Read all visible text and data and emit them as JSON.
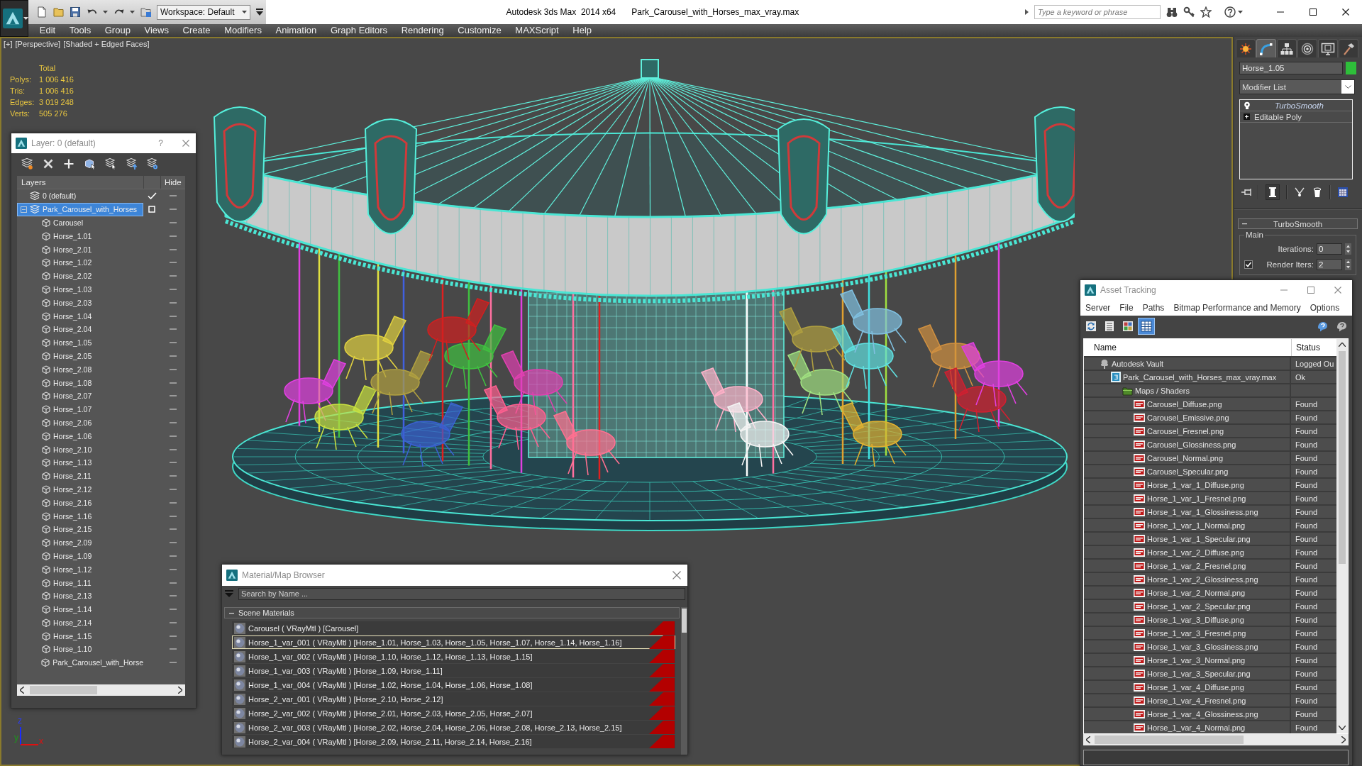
{
  "title_bar": {
    "workspace": "Workspace: Default",
    "app_title": "Autodesk 3ds Max  2014 x64",
    "file_name": "Park_Carousel_with_Horses_max_vray.max",
    "search": {
      "placeholder": "Type a keyword or phrase"
    }
  },
  "menu_bar": {
    "items": [
      "Edit",
      "Tools",
      "Group",
      "Views",
      "Create",
      "Modifiers",
      "Animation",
      "Graph Editors",
      "Rendering",
      "Customize",
      "MAXScript",
      "Help"
    ]
  },
  "viewport": {
    "labels": [
      "[+]",
      "[Perspective]",
      "[Shaded + Edged Faces]"
    ],
    "stats": {
      "heading": "Total",
      "rows": [
        {
          "label": "Polys:",
          "value": "1 006 416"
        },
        {
          "label": "Tris:",
          "value": "1 006 416"
        },
        {
          "label": "Edges:",
          "value": "3 019 248"
        },
        {
          "label": "Verts:",
          "value": "505 276"
        }
      ]
    },
    "axis_labels": [
      "z",
      "y",
      "x"
    ]
  },
  "command_panel": {
    "tabs": [
      {
        "kind": "create",
        "selected": false
      },
      {
        "kind": "modify",
        "selected": true
      },
      {
        "kind": "hierarchy",
        "selected": false
      },
      {
        "kind": "motion",
        "selected": false
      },
      {
        "kind": "display",
        "selected": false
      },
      {
        "kind": "utilities",
        "selected": false
      }
    ],
    "object_name": "Horse_1.05",
    "modifier_list": "Modifier List",
    "stack": [
      {
        "name": "TurboSmooth",
        "kind": "modifier"
      },
      {
        "name": "Editable Poly",
        "kind": "base"
      }
    ],
    "rollout": {
      "title": "TurboSmooth",
      "expanded": true,
      "group": "Main",
      "fields": [
        {
          "kind": "spinner",
          "label": "Iterations:",
          "value": "0"
        },
        {
          "kind": "check_spinner",
          "label": "Render Iters:",
          "value": "2",
          "checked": true
        }
      ]
    }
  },
  "layer_window": {
    "title": "Layer: 0 (default)",
    "help_label": "?",
    "columns": [
      "Layers",
      "Hide"
    ],
    "layers": [
      {
        "name": "0 (default)",
        "current": true,
        "selected": false,
        "hidden": false
      },
      {
        "name": "Park_Carousel_with_Horses",
        "current": false,
        "selected": true,
        "hidden": false,
        "expanded": true,
        "children": [
          {
            "name": "Carousel",
            "selected": false,
            "hidden": false
          },
          {
            "name": "Horse_1.01",
            "selected": false,
            "hidden": false
          },
          {
            "name": "Horse_2.01",
            "selected": false,
            "hidden": false
          },
          {
            "name": "Horse_1.02",
            "selected": false,
            "hidden": false
          },
          {
            "name": "Horse_2.02",
            "selected": false,
            "hidden": false
          },
          {
            "name": "Horse_1.03",
            "selected": false,
            "hidden": false
          },
          {
            "name": "Horse_2.03",
            "selected": false,
            "hidden": false
          },
          {
            "name": "Horse_1.04",
            "selected": false,
            "hidden": false
          },
          {
            "name": "Horse_2.04",
            "selected": false,
            "hidden": false
          },
          {
            "name": "Horse_1.05",
            "selected": false,
            "hidden": false
          },
          {
            "name": "Horse_2.05",
            "selected": false,
            "hidden": false
          },
          {
            "name": "Horse_2.08",
            "selected": false,
            "hidden": false
          },
          {
            "name": "Horse_1.08",
            "selected": false,
            "hidden": false
          },
          {
            "name": "Horse_2.07",
            "selected": false,
            "hidden": false
          },
          {
            "name": "Horse_1.07",
            "selected": false,
            "hidden": false
          },
          {
            "name": "Horse_2.06",
            "selected": false,
            "hidden": false
          },
          {
            "name": "Horse_1.06",
            "selected": false,
            "hidden": false
          },
          {
            "name": "Horse_2.10",
            "selected": false,
            "hidden": false
          },
          {
            "name": "Horse_1.13",
            "selected": false,
            "hidden": false
          },
          {
            "name": "Horse_2.11",
            "selected": false,
            "hidden": false
          },
          {
            "name": "Horse_2.12",
            "selected": false,
            "hidden": false
          },
          {
            "name": "Horse_2.16",
            "selected": false,
            "hidden": false
          },
          {
            "name": "Horse_1.16",
            "selected": false,
            "hidden": false
          },
          {
            "name": "Horse_2.15",
            "selected": false,
            "hidden": false
          },
          {
            "name": "Horse_2.09",
            "selected": false,
            "hidden": false
          },
          {
            "name": "Horse_1.09",
            "selected": false,
            "hidden": false
          },
          {
            "name": "Horse_1.12",
            "selected": false,
            "hidden": false
          },
          {
            "name": "Horse_1.11",
            "selected": false,
            "hidden": false
          },
          {
            "name": "Horse_2.13",
            "selected": false,
            "hidden": false
          },
          {
            "name": "Horse_1.14",
            "selected": false,
            "hidden": false
          },
          {
            "name": "Horse_2.14",
            "selected": false,
            "hidden": false
          },
          {
            "name": "Horse_1.15",
            "selected": false,
            "hidden": false
          },
          {
            "name": "Horse_1.10",
            "selected": false,
            "hidden": false
          },
          {
            "name": "Park_Carousel_with_Horse",
            "selected": false,
            "hidden": false
          }
        ]
      }
    ]
  },
  "material_browser": {
    "title": "Material/Map Browser",
    "search": {
      "placeholder": "Search by Name ..."
    },
    "groups": [
      {
        "title": "Scene Materials",
        "expanded": true,
        "items": [
          {
            "label": "Carousel ( VRayMtl ) [Carousel]",
            "selected": false
          },
          {
            "label": "Horse_1_var_001 ( VRayMtl ) [Horse_1.01, Horse_1.03, Horse_1.05, Horse_1.07, Horse_1.14, Horse_1.16]",
            "selected": true
          },
          {
            "label": "Horse_1_var_002 ( VRayMtl ) [Horse_1.10, Horse_1.12, Horse_1.13, Horse_1.15]",
            "selected": false
          },
          {
            "label": "Horse_1_var_003 ( VRayMtl ) [Horse_1.09, Horse_1.11]",
            "selected": false
          },
          {
            "label": "Horse_1_var_004 ( VRayMtl ) [Horse_1.02, Horse_1.04, Horse_1.06, Horse_1.08]",
            "selected": false
          },
          {
            "label": "Horse_2_var_001 ( VRayMtl ) [Horse_2.10, Horse_2.12]",
            "selected": false
          },
          {
            "label": "Horse_2_var_002 ( VRayMtl ) [Horse_2.01, Horse_2.03, Horse_2.05, Horse_2.07]",
            "selected": false
          },
          {
            "label": "Horse_2_var_003 ( VRayMtl ) [Horse_2.02, Horse_2.04, Horse_2.06, Horse_2.08, Horse_2.13, Horse_2.15]",
            "selected": false
          },
          {
            "label": "Horse_2_var_004 ( VRayMtl ) [Horse_2.09, Horse_2.11, Horse_2.14, Horse_2.16]",
            "selected": false
          }
        ]
      }
    ]
  },
  "asset_tracking": {
    "title": "Asset Tracking",
    "menu": [
      "Server",
      "File",
      "Paths",
      "Bitmap Performance and Memory",
      "Options"
    ],
    "view_modes": [
      {
        "kind": "list",
        "selected": false
      },
      {
        "kind": "thumbnails",
        "selected": false
      },
      {
        "kind": "table",
        "selected": true
      }
    ],
    "columns": [
      "Name",
      "Status"
    ],
    "assets": [
      {
        "name": "Autodesk Vault",
        "status": "Logged Ou",
        "kind": "vault",
        "children": [
          {
            "name": "Park_Carousel_with_Horses_max_vray.max",
            "status": "Ok",
            "kind": "scene",
            "children": [
              {
                "name": "Maps / Shaders",
                "kind": "folder",
                "children": [
                  {
                    "name": "Carousel_Diffuse.png",
                    "status": "Found",
                    "kind": "image"
                  },
                  {
                    "name": "Carousel_Emissive.png",
                    "status": "Found",
                    "kind": "image"
                  },
                  {
                    "name": "Carousel_Fresnel.png",
                    "status": "Found",
                    "kind": "image"
                  },
                  {
                    "name": "Carousel_Glossiness.png",
                    "status": "Found",
                    "kind": "image"
                  },
                  {
                    "name": "Carousel_Normal.png",
                    "status": "Found",
                    "kind": "image"
                  },
                  {
                    "name": "Carousel_Specular.png",
                    "status": "Found",
                    "kind": "image"
                  },
                  {
                    "name": "Horse_1_var_1_Diffuse.png",
                    "status": "Found",
                    "kind": "image"
                  },
                  {
                    "name": "Horse_1_var_1_Fresnel.png",
                    "status": "Found",
                    "kind": "image"
                  },
                  {
                    "name": "Horse_1_var_1_Glossiness.png",
                    "status": "Found",
                    "kind": "image"
                  },
                  {
                    "name": "Horse_1_var_1_Normal.png",
                    "status": "Found",
                    "kind": "image"
                  },
                  {
                    "name": "Horse_1_var_1_Specular.png",
                    "status": "Found",
                    "kind": "image"
                  },
                  {
                    "name": "Horse_1_var_2_Diffuse.png",
                    "status": "Found",
                    "kind": "image"
                  },
                  {
                    "name": "Horse_1_var_2_Fresnel.png",
                    "status": "Found",
                    "kind": "image"
                  },
                  {
                    "name": "Horse_1_var_2_Glossiness.png",
                    "status": "Found",
                    "kind": "image"
                  },
                  {
                    "name": "Horse_1_var_2_Normal.png",
                    "status": "Found",
                    "kind": "image"
                  },
                  {
                    "name": "Horse_1_var_2_Specular.png",
                    "status": "Found",
                    "kind": "image"
                  },
                  {
                    "name": "Horse_1_var_3_Diffuse.png",
                    "status": "Found",
                    "kind": "image"
                  },
                  {
                    "name": "Horse_1_var_3_Fresnel.png",
                    "status": "Found",
                    "kind": "image"
                  },
                  {
                    "name": "Horse_1_var_3_Glossiness.png",
                    "status": "Found",
                    "kind": "image"
                  },
                  {
                    "name": "Horse_1_var_3_Normal.png",
                    "status": "Found",
                    "kind": "image"
                  },
                  {
                    "name": "Horse_1_var_3_Specular.png",
                    "status": "Found",
                    "kind": "image"
                  },
                  {
                    "name": "Horse_1_var_4_Diffuse.png",
                    "status": "Found",
                    "kind": "image"
                  },
                  {
                    "name": "Horse_1_var_4_Fresnel.png",
                    "status": "Found",
                    "kind": "image"
                  },
                  {
                    "name": "Horse_1_var_4_Glossiness.png",
                    "status": "Found",
                    "kind": "image"
                  },
                  {
                    "name": "Horse_1_var_4_Normal.png",
                    "status": "Found",
                    "kind": "image"
                  }
                ]
              }
            ]
          }
        ]
      }
    ]
  }
}
